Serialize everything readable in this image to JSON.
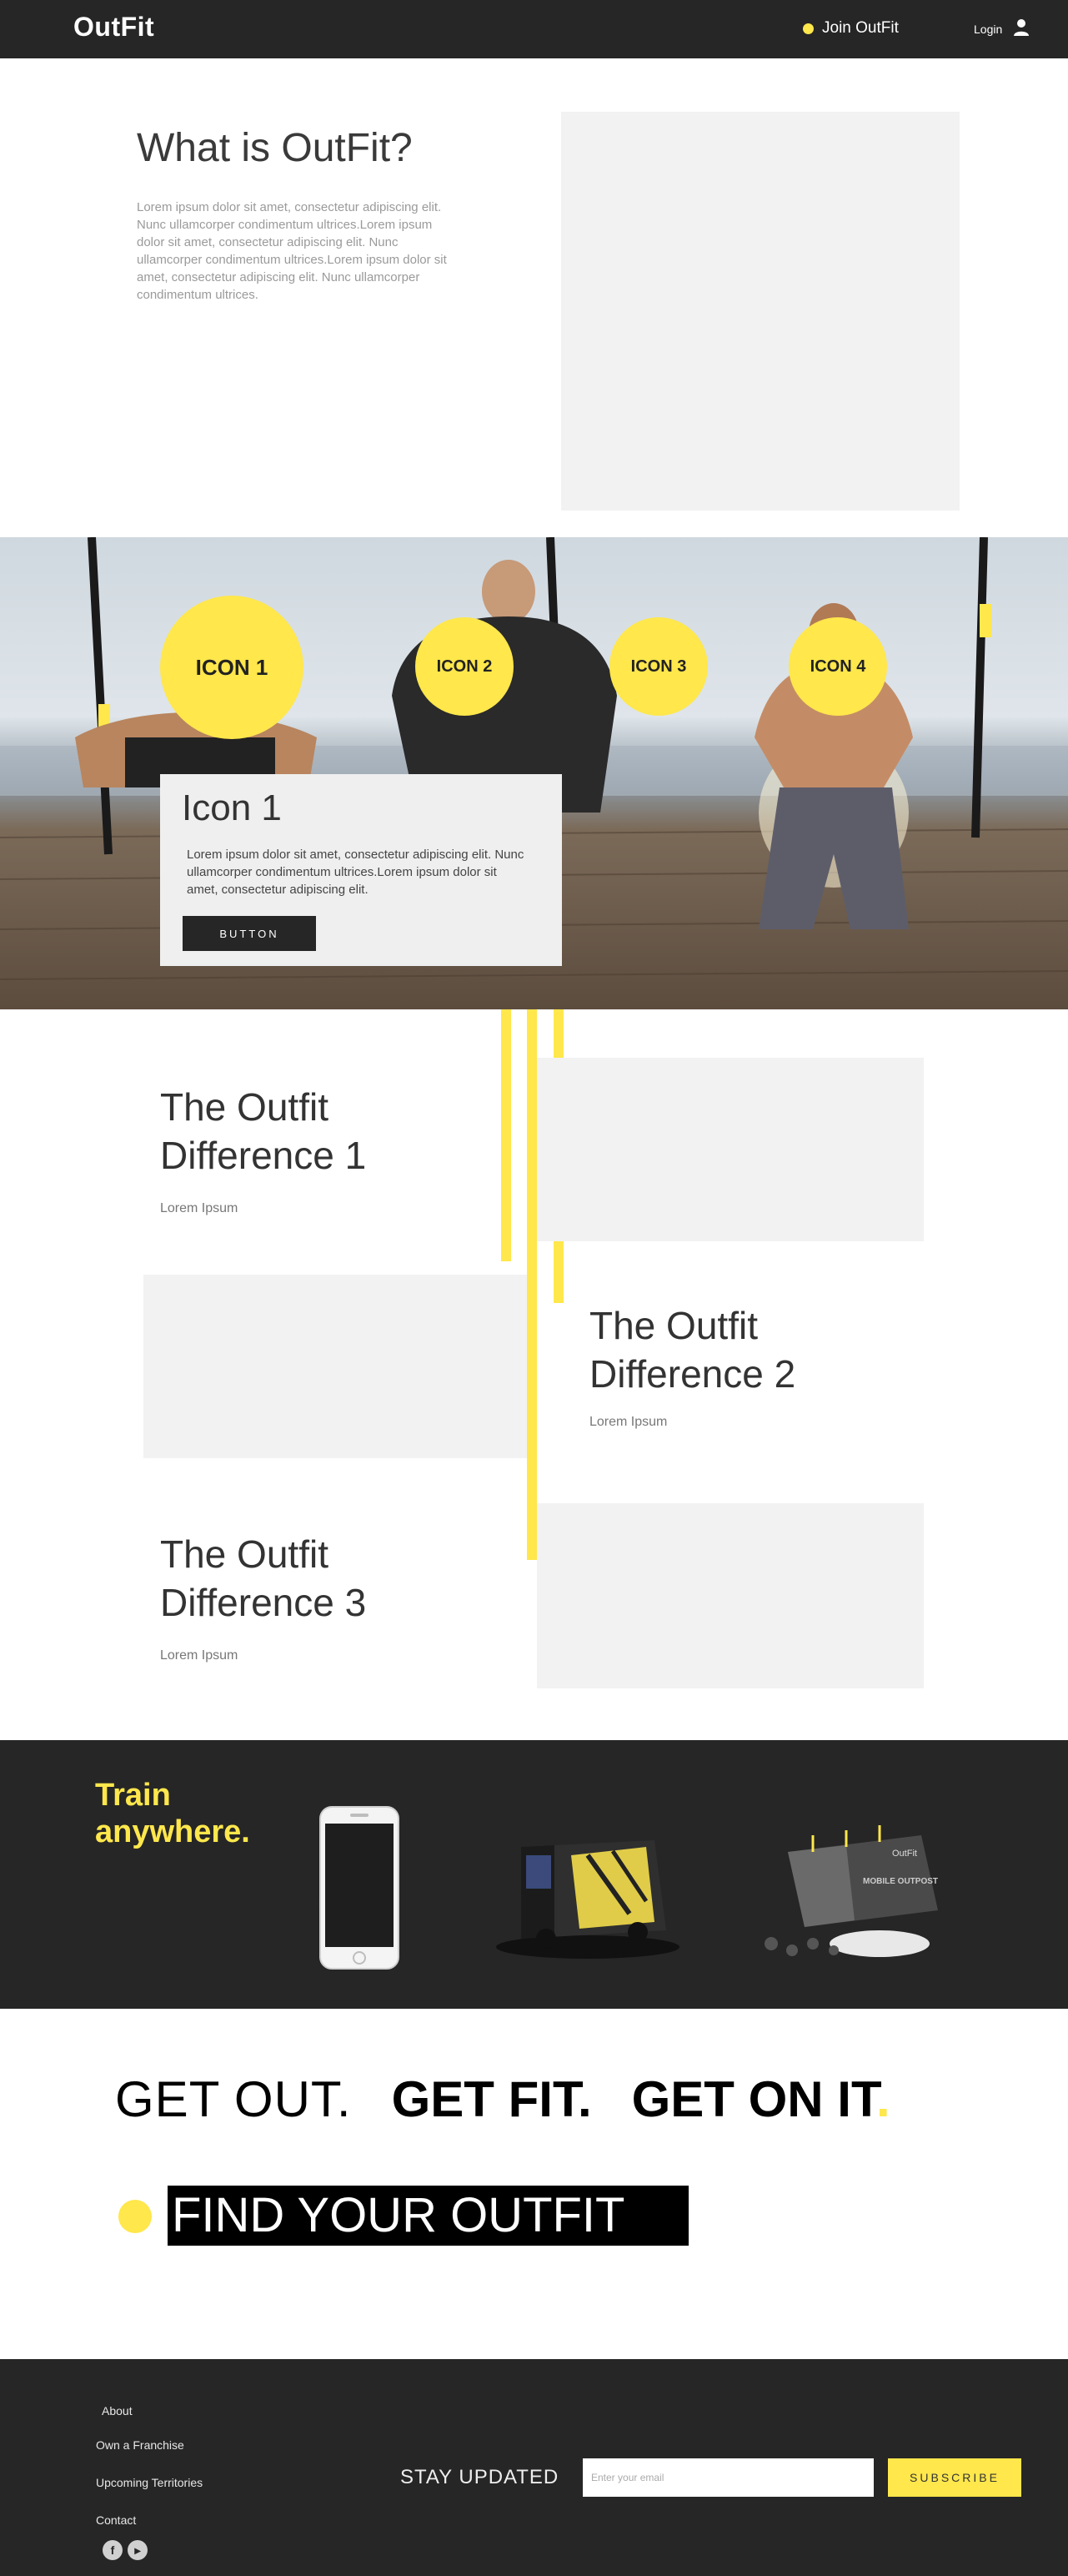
{
  "header": {
    "logo": "OutFit",
    "join_label": "Join OutFit",
    "login_label": "Login"
  },
  "what_is": {
    "title": "What is OutFit?",
    "body": "Lorem ipsum dolor sit amet, consectetur adipiscing elit. Nunc ullamcorper condimentum ultrices.Lorem ipsum dolor sit amet, consectetur adipiscing elit. Nunc ullamcorper condimentum ultrices.Lorem ipsum dolor sit amet, consectetur adipiscing elit. Nunc ullamcorper condimentum ultrices."
  },
  "icons": {
    "items": [
      "ICON 1",
      "ICON 2",
      "ICON 3",
      "ICON 4"
    ],
    "card_title": "Icon 1",
    "card_body": "Lorem ipsum dolor sit amet, consectetur adipiscing elit. Nunc ullamcorper condimentum ultrices.Lorem ipsum dolor sit amet, consectetur adipiscing elit.",
    "card_button": "BUTTON"
  },
  "difference": [
    {
      "title": "The Outfit Difference 1",
      "subtitle": "Lorem Ipsum"
    },
    {
      "title": "The Outfit Difference 2",
      "subtitle": "Lorem Ipsum"
    },
    {
      "title": "The Outfit Difference 3",
      "subtitle": "Lorem Ipsum"
    }
  ],
  "train": {
    "title_line1": "Train",
    "title_line2": "anywhere.",
    "container_brand": "OutFit",
    "container_text": "MOBILE OUTPOST"
  },
  "slogan": {
    "part1": "GET OUT.",
    "part2": "GET FIT.",
    "part3": "GET ON IT",
    "dot": ".",
    "find": "FIND YOUR OUTFIT"
  },
  "footer": {
    "links": [
      "About",
      "Own a Franchise",
      "Upcoming Territories",
      "Contact"
    ],
    "social": [
      "f",
      "▸"
    ],
    "stay_updated": "STAY UPDATED",
    "email_placeholder": "Enter your email",
    "subscribe_label": "SUBSCRIBE"
  },
  "colors": {
    "accent": "#ffe74c",
    "dark": "#262626",
    "placeholder_gray": "#f2f2f2"
  }
}
